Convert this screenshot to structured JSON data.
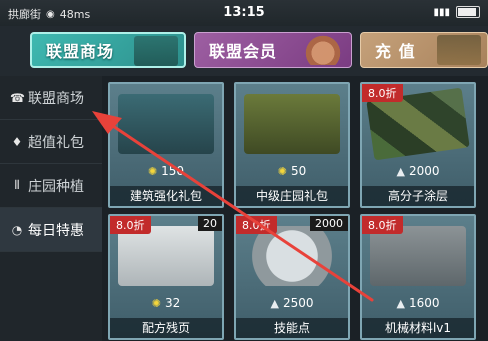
{
  "status_bar": {
    "carrier": "拱廊街",
    "speed": "48ms",
    "time": "13:15"
  },
  "tabs": [
    {
      "label": "联盟商场",
      "active": true
    },
    {
      "label": "联盟会员",
      "active": false
    },
    {
      "label": "充  值",
      "active": false
    }
  ],
  "sidebar": {
    "items": [
      {
        "label": "联盟商场",
        "icon": "shop-icon",
        "active": false
      },
      {
        "label": "超值礼包",
        "icon": "diamond-icon",
        "active": false
      },
      {
        "label": "庄园种植",
        "icon": "plant-icon",
        "active": false
      },
      {
        "label": "每日特惠",
        "icon": "timer-icon",
        "active": true
      }
    ]
  },
  "products": [
    {
      "name": "建筑强化礼包",
      "price": "150",
      "currency": "gold-coin",
      "discount": "",
      "stock": ""
    },
    {
      "name": "中级庄园礼包",
      "price": "50",
      "currency": "gold-coin",
      "discount": "",
      "stock": ""
    },
    {
      "name": "高分子涂层",
      "price": "2000",
      "currency": "diamond",
      "discount": "8.0折",
      "stock": ""
    },
    {
      "name": "配方残页",
      "price": "32",
      "currency": "gold-coin",
      "discount": "8.0折",
      "stock": "20"
    },
    {
      "name": "技能点",
      "price": "2500",
      "currency": "diamond",
      "discount": "8.0折",
      "stock": "2000"
    },
    {
      "name": "机械材料lv1",
      "price": "1600",
      "currency": "diamond",
      "discount": "8.0折",
      "stock": ""
    }
  ],
  "colors": {
    "accent_tab": "#3fb9b1",
    "discount_badge": "#c22b2b",
    "annotation_arrow": "#e8423a"
  }
}
